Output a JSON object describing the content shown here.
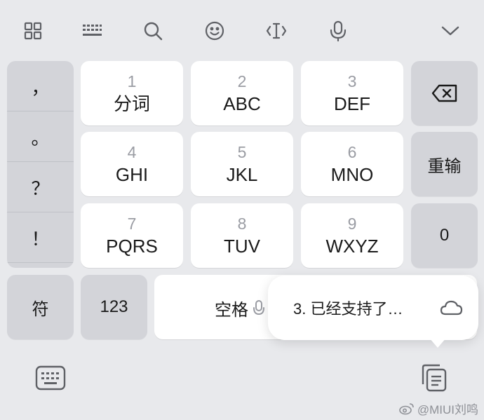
{
  "toolbar": {
    "icons": [
      "grid-icon",
      "keyboard-dots-icon",
      "search-icon",
      "emoji-icon",
      "text-cursor-icon",
      "microphone-icon",
      "chevron-down-icon"
    ]
  },
  "punctuation": {
    "items": [
      "，",
      "。",
      "？",
      "！"
    ]
  },
  "keys": {
    "k1": {
      "num": "1",
      "letters": "分词"
    },
    "k2": {
      "num": "2",
      "letters": "ABC"
    },
    "k3": {
      "num": "3",
      "letters": "DEF"
    },
    "k4": {
      "num": "4",
      "letters": "GHI"
    },
    "k5": {
      "num": "5",
      "letters": "JKL"
    },
    "k6": {
      "num": "6",
      "letters": "MNO"
    },
    "k7": {
      "num": "7",
      "letters": "PQRS"
    },
    "k8": {
      "num": "8",
      "letters": "TUV"
    },
    "k9": {
      "num": "9",
      "letters": "WXYZ"
    }
  },
  "right_keys": {
    "retype": "重输",
    "zero": "0"
  },
  "bottom_row": {
    "symbols": "符",
    "numbers": "123",
    "space": "空格"
  },
  "popup": {
    "text": "3. 已经支持了…"
  },
  "watermark": {
    "text": "@MIUI刘鸣"
  }
}
